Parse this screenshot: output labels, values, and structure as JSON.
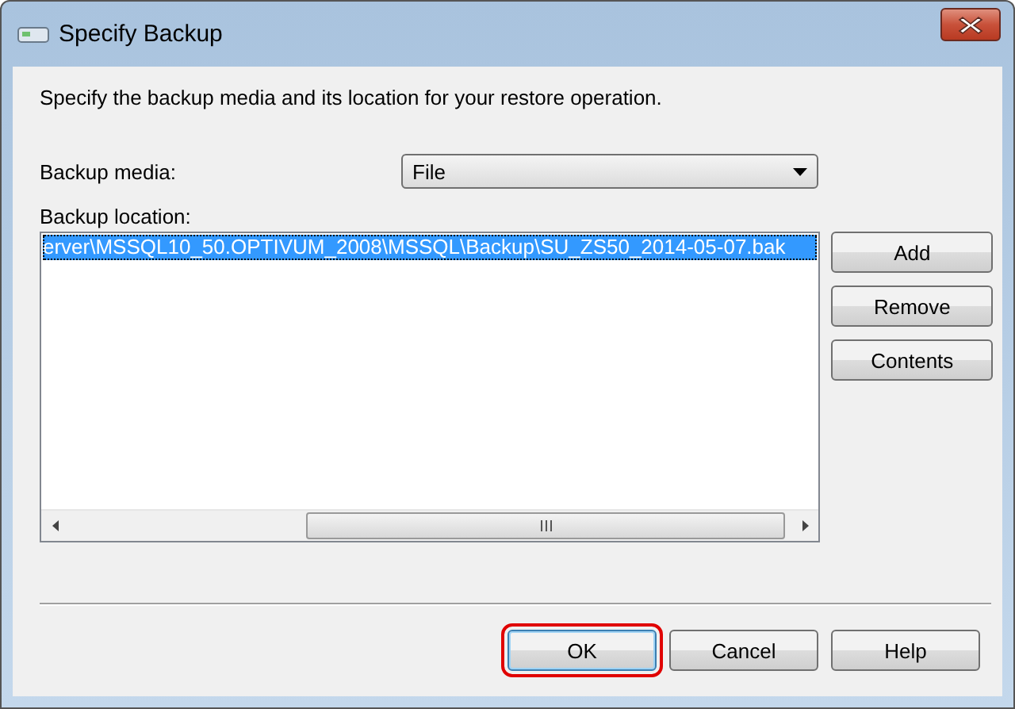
{
  "window": {
    "title": "Specify Backup"
  },
  "instructions": "Specify the backup media and its location for your restore operation.",
  "backup_media": {
    "label": "Backup media:",
    "value": "File"
  },
  "backup_location": {
    "label": "Backup location:",
    "items": [
      {
        "text": "erver\\MSSQL10_50.OPTIVUM_2008\\MSSQL\\Backup\\SU_ZS50_2014-05-07.bak",
        "selected": true
      }
    ]
  },
  "side_buttons": [
    "Add",
    "Remove",
    "Contents"
  ],
  "buttons": [
    {
      "label": "OK",
      "highlighted": true
    },
    {
      "label": "Cancel",
      "highlighted": false
    },
    {
      "label": "Help",
      "highlighted": false
    }
  ]
}
